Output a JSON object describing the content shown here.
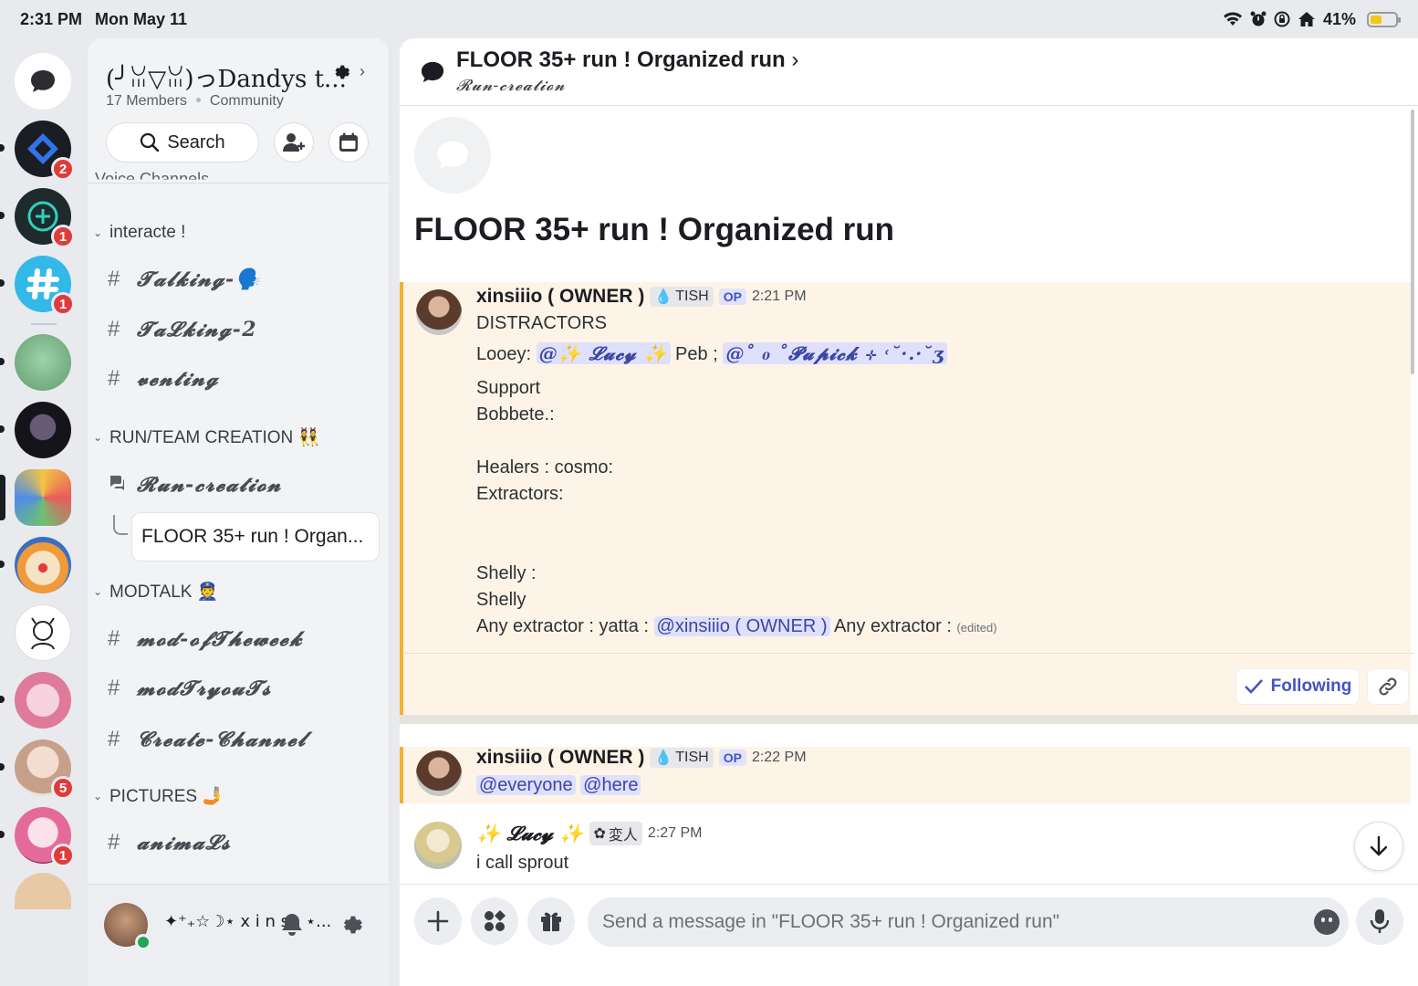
{
  "status_bar": {
    "time": "2:31 PM",
    "date": "Mon May 11",
    "battery": "41%",
    "battery_level": 0.41
  },
  "rail": {
    "badges": {
      "server1": "2",
      "server2": "1",
      "server3": "1",
      "server9": "5",
      "server10": "1"
    }
  },
  "server": {
    "name": "(╯ꈍ▽ꈍ)っDandys t...",
    "members": "17 Members",
    "type": "Community",
    "search_label": "Search",
    "cut_category": "Voice Channels"
  },
  "categories": {
    "interacte": "interacte !",
    "run_team": "RUN/TEAM CREATION 👯",
    "modtalk": "MODTALK 👮",
    "pictures": "PICTURES 🤳"
  },
  "channels": {
    "talking": "𝓣𝓪𝓵𝓴𝓲𝓷𝓰-🗣️",
    "talking2": "𝓣𝓪𝓛𝓴𝓲𝓷𝓰-2",
    "venting": "𝓿𝓮𝓷𝓽𝓲𝓷𝓰",
    "run_creation": "𝓡𝓾𝓷-𝓬𝓻𝓮𝓪𝓽𝓲𝓸𝓷",
    "thread": "FLOOR 35+ run ! Organ...",
    "mod_of_week": "𝓶𝓸𝓭-𝓸𝓯𝓣𝓱𝓮𝔀𝓮𝓮𝓴",
    "mod_tryouts": "𝓶𝓸𝓭𝓣𝓻𝔂𝓸𝓾𝓣𝓼",
    "create_channel": "𝓒𝓻𝓮𝓪𝓽𝓮-𝓒𝓱𝓪𝓷𝓷𝓮𝓵",
    "animals": "𝓪𝓷𝓲𝓶𝓪𝓛𝓼"
  },
  "user": {
    "name": "✦⁺₊☆☽⋆ x i n s ᵢᵢ ⋆..."
  },
  "thread": {
    "title": "FLOOR 35+ run ! Organized run",
    "parent": "𝓡𝓾𝓷-𝓬𝓻𝓮𝓪𝓽𝓲𝓸𝓷",
    "big_title": "FLOOR 35+ run ! Organized run"
  },
  "messages": {
    "m1": {
      "author": "xinsiiio ( OWNER )",
      "tag": "TISH",
      "op": "OP",
      "time": "2:21 PM",
      "l1": "DISTRACTORS",
      "l2_a": "Looey: ",
      "l2_mention1": "@✨ 𝓛𝓾𝓬𝔂 ✨",
      "l2_b": " Peb ; ",
      "l2_mention2": "@˚ ₀ ˚𝓟𝓾𝓹𝓲𝓬𝓴 ⊹ ˓˘·.·˘ʒ",
      "l3": "Support",
      "l4": "Bobbete.:",
      "l5": "Healers : cosmo:",
      "l6": "Extractors:",
      "l7": "Shelly :",
      "l8": "Shelly",
      "l9_a": "Any extractor : yatta : ",
      "l9_mention": "@xinsiiio ( OWNER )",
      "l9_b": " Any extractor : ",
      "edited": "(edited)",
      "following": "Following"
    },
    "m2": {
      "author": "xinsiiio ( OWNER )",
      "tag": "TISH",
      "op": "OP",
      "time": "2:22 PM",
      "mention1": "@everyone",
      "mention2": "@here"
    },
    "m3": {
      "author": "✨ 𝓛𝓾𝓬𝔂 ✨",
      "tag": "変人",
      "time": "2:27 PM",
      "text": "i call sprout"
    }
  },
  "composer": {
    "placeholder": "Send a message in \"FLOOR 35+ run ! Organized run\""
  },
  "colors": {
    "accent": "#5865f2",
    "starter_bg": "#fdf4e7",
    "starter_border": "#f0b232",
    "mention_bg": "#dee0fc"
  }
}
